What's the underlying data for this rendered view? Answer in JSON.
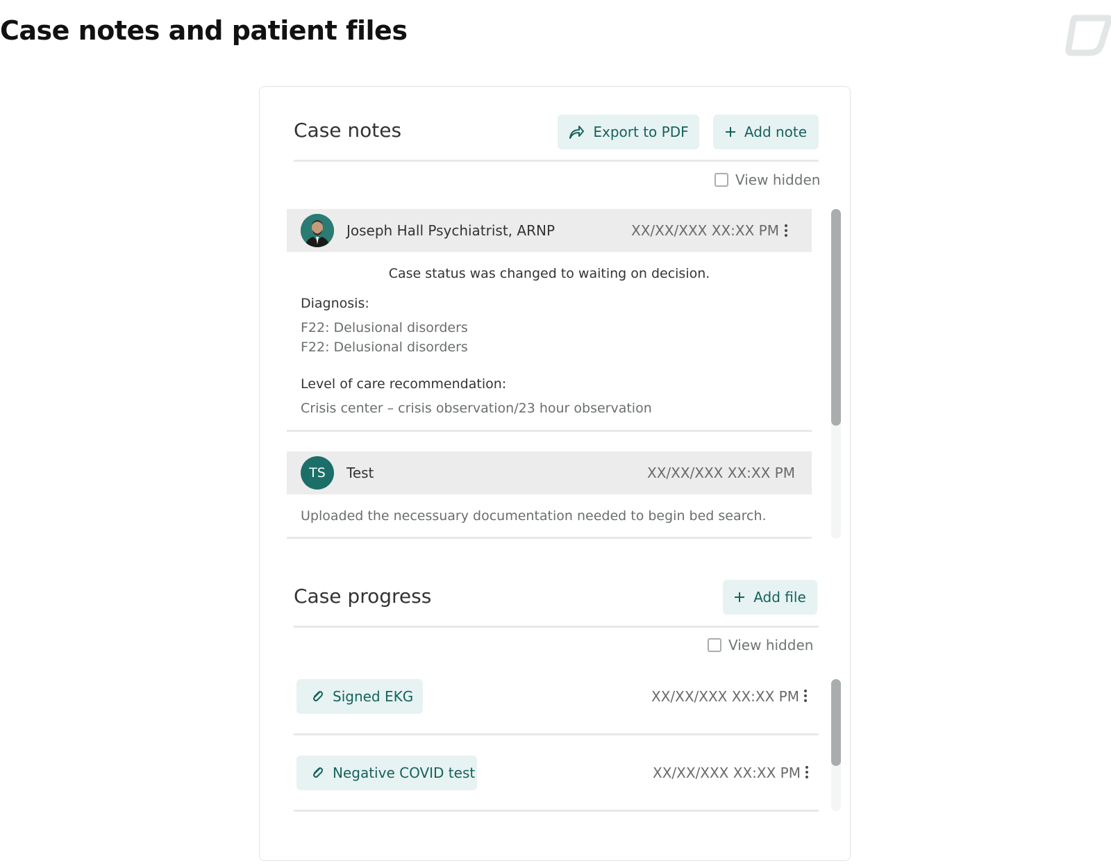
{
  "page": {
    "title": "Case notes and patient files"
  },
  "case_notes": {
    "title": "Case notes",
    "export_label": "Export to PDF",
    "add_note_label": "Add note",
    "view_hidden_label": "View hidden",
    "notes": [
      {
        "author": "Joseph Hall Psychiatrist, ARNP",
        "timestamp": "XX/XX/XXX XX:XX PM",
        "status": "Case status was changed to waiting on decision.",
        "diagnosis_label": "Diagnosis:",
        "diagnoses": [
          "F22: Delusional disorders",
          "F22: Delusional disorders"
        ],
        "care_label": "Level of care recommendation:",
        "care_value": "Crisis center – crisis observation/23 hour observation"
      },
      {
        "avatar_initials": "TS",
        "author": "Test",
        "timestamp": "XX/XX/XXX XX:XX PM",
        "body": "Uploaded the necessuary documentation needed to begin bed search."
      }
    ]
  },
  "case_progress": {
    "title": "Case progress",
    "add_file_label": "Add file",
    "view_hidden_label": "View hidden",
    "files": [
      {
        "name": "Signed EKG",
        "timestamp": "XX/XX/XXX XX:XX PM"
      },
      {
        "name": "Negative COVID test",
        "timestamp": "XX/XX/XXX XX:XX PM"
      }
    ]
  },
  "colors": {
    "accent": "#17615c",
    "accent_bg": "#e6f3f2",
    "avatar_bg": "#1c6e68",
    "note_header_bg": "#ececec"
  },
  "icons": [
    "brand-logo",
    "share-icon",
    "plus-icon",
    "kebab-menu-icon",
    "paperclip-icon"
  ]
}
